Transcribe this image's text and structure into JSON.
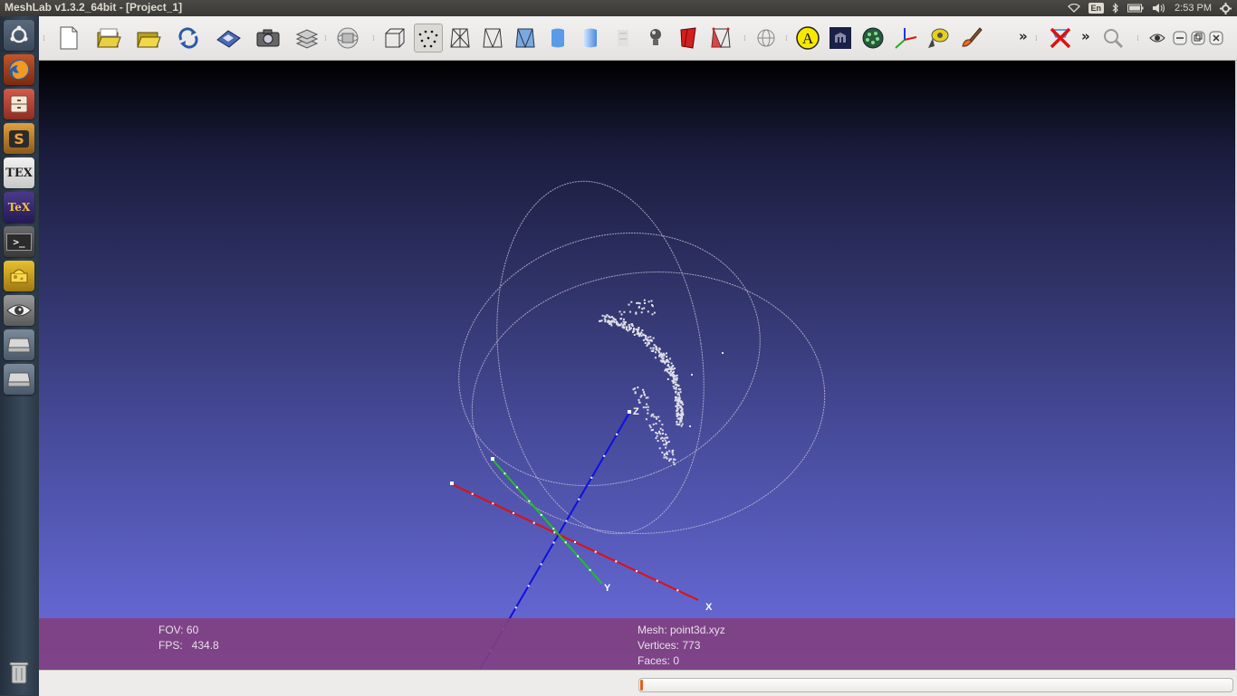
{
  "window": {
    "title": "MeshLab v1.3.2_64bit - [Project_1]"
  },
  "panel": {
    "clock": "2:53 PM",
    "keyboard_layout": "En",
    "icons": [
      "wifi-icon",
      "keyboard-layout-icon",
      "bluetooth-icon",
      "battery-icon",
      "volume-icon",
      "session-gear-icon"
    ]
  },
  "launcher": {
    "items": [
      {
        "name": "dash-home",
        "icon": "ubuntu-logo-icon"
      },
      {
        "name": "firefox",
        "icon": "firefox-icon"
      },
      {
        "name": "files",
        "icon": "file-cabinet-icon"
      },
      {
        "name": "sublime-text",
        "icon": "sublime-s-icon",
        "label": "S"
      },
      {
        "name": "texmaker",
        "icon": "tex-icon",
        "label": "TEX"
      },
      {
        "name": "texstudio",
        "icon": "texstudio-icon",
        "label": "TeX"
      },
      {
        "name": "terminal",
        "icon": "terminal-icon",
        "label": ">_"
      },
      {
        "name": "cheese",
        "icon": "cheese-icon"
      },
      {
        "name": "meshlab",
        "icon": "meshlab-eye-icon"
      },
      {
        "name": "drive-1",
        "icon": "drive-icon"
      },
      {
        "name": "drive-2",
        "icon": "drive-icon"
      },
      {
        "name": "trash",
        "icon": "trash-icon"
      }
    ]
  },
  "toolbar": {
    "buttons": [
      "new-project",
      "open-project",
      "open-mesh",
      "reload",
      "save-snapshot",
      "snapshot",
      "layers",
      "trackball-reset",
      "bounding-box",
      "points",
      "wireframe",
      "hidden-lines",
      "flat-lines",
      "flat",
      "smooth",
      "texture",
      "light",
      "back-face",
      "selected-faces",
      "info",
      "annotation",
      "texture-param",
      "quality",
      "axes",
      "measure",
      "paint",
      "delete",
      "search",
      "view",
      "minimize",
      "restore",
      "close"
    ],
    "active": "points",
    "annotation_label": "A"
  },
  "viewport": {
    "fov_label": "FOV: 60",
    "fps_label": "FPS:   434.8",
    "mesh_label": "Mesh: point3d.xyz",
    "vertices_label": "Vertices: 773",
    "faces_label": "Faces: 0",
    "axes": {
      "x_label": "X",
      "y_label": "Y",
      "z_label": "Z",
      "x_color": "#e01010",
      "y_color": "#20c020",
      "z_color": "#1010e0"
    },
    "background_top": "#000000",
    "background_bottom": "#6c6ee0",
    "info_bar_color": "#804080"
  },
  "statusbar": {
    "progress": 0.004
  }
}
